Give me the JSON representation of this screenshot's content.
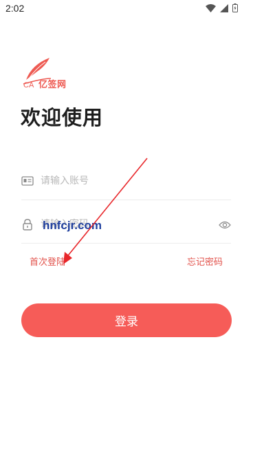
{
  "status_bar": {
    "time": "2:02"
  },
  "brand": {
    "name": "亿签网",
    "ca_label": "CA",
    "accent_color": "#ee5a52"
  },
  "page": {
    "title": "欢迎使用"
  },
  "account_field": {
    "placeholder": "请输入账号",
    "icon": "id-card-icon"
  },
  "password_field": {
    "placeholder": "请输入密码",
    "icon": "lock-icon",
    "toggle_icon": "eye-icon"
  },
  "links": {
    "first_login": "首次登陆",
    "forgot_password": "忘记密码"
  },
  "login_button": {
    "label": "登录",
    "color": "#f65c58"
  },
  "watermark": {
    "text": "hnfcjr.com"
  },
  "annotation": {
    "arrow_color": "#e8262a"
  }
}
